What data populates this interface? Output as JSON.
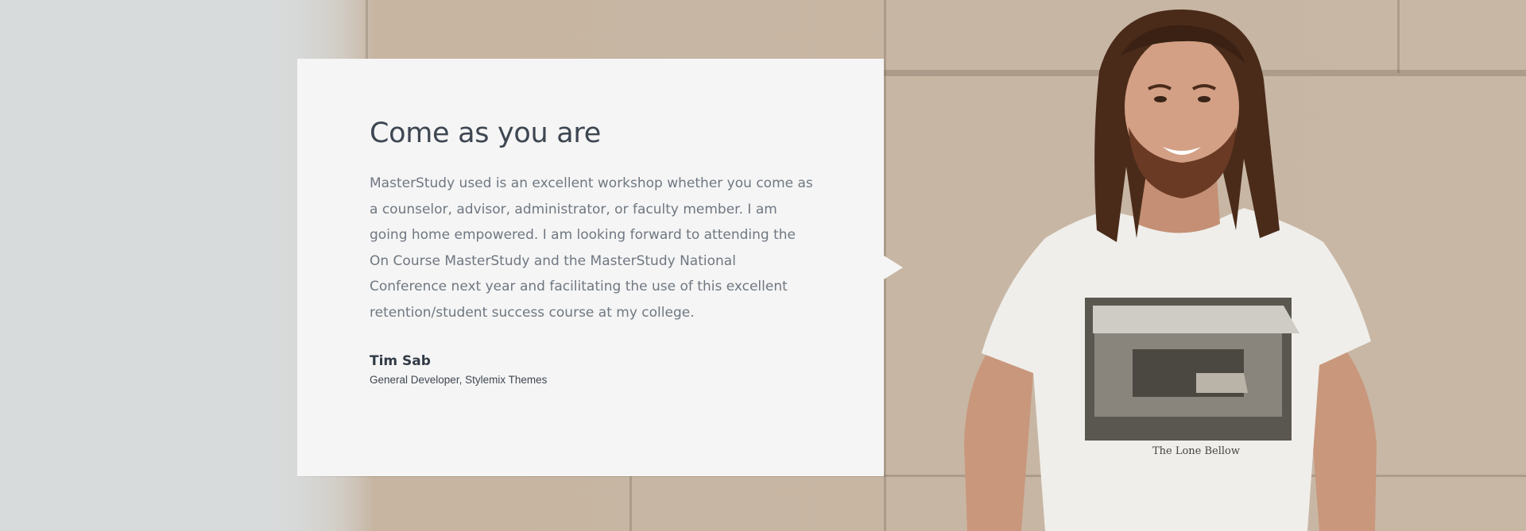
{
  "testimonial": {
    "title": "Come as you are",
    "quote": "MasterStudy used is an excellent workshop whether you come as a counselor, advisor, administrator, or faculty member. I am going home empowered. I am looking forward to attending the On Course MasterStudy and the MasterStudy National Conference next year and facilitating the use of this excellent retention/student success course at my college.",
    "author_name": "Tim Sab",
    "author_role": "General Developer, Stylemix Themes"
  },
  "photo": {
    "shirt_print_text": "The Lone Bellow"
  },
  "colors": {
    "card_background": "#f5f5f5",
    "title": "#3d4651",
    "body_text": "#6f7781",
    "wall": "#c8b7a5",
    "left_panel": "#d8dbdc"
  }
}
